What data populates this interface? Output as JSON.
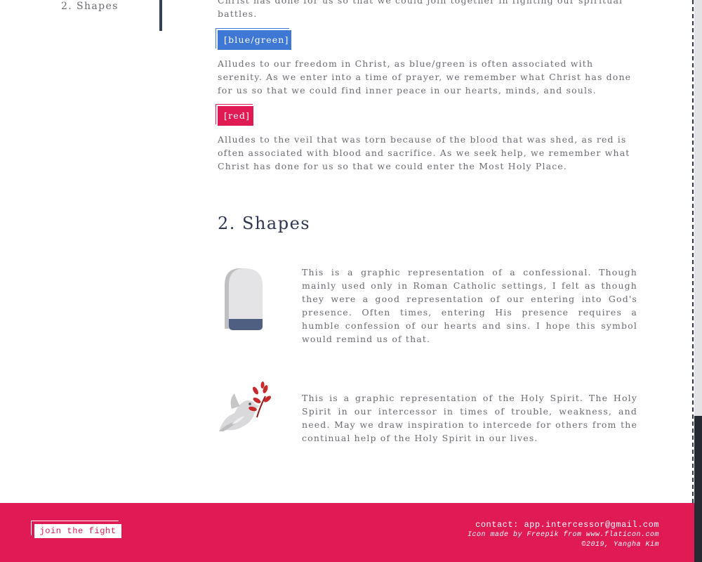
{
  "sidebar": {
    "active_item": "2. Shapes"
  },
  "colors_section": {
    "intro_tail_line1": "Christ has done for us so that we could join together in fighting our spiritual",
    "intro_tail_line2": "battles.",
    "blue_tag": "[blue/green]",
    "blue_text": "Alludes to our freedom in Christ, as blue/green is often associated with serenity. As we enter into a time of prayer, we remember what Christ has done for us so that we could find inner peace in our hearts, minds, and souls.",
    "red_tag": "[red]",
    "red_text": "Alludes to the veil that was torn because of the blood that was shed, as red is often associated with blood and sacrifice. As we seek help, we remember what Christ has done for us so that we could enter the Most Holy Place."
  },
  "shapes_section": {
    "heading": "2. Shapes",
    "confessional_icon": "confessional-icon",
    "confessional_text": "This is a graphic representation of a confessional. Though mainly used only in Roman Catholic settings, I felt as though they were a good representation of our entering into God's presence. Often times, entering His presence requires a humble confession of our hearts and sins. I hope this symbol would remind us of that.",
    "dove_icon": "dove-icon",
    "dove_text": "This is a graphic representation of the Holy Spirit. The Holy Spirit in our intercessor in times of trouble, weakness, and need. May we draw inspiration to intercede for others from the continual help of the Holy Spirit in our lives."
  },
  "footer": {
    "join_label": "join the fight",
    "contact": "contact: app.intercessor@gmail.com",
    "icon_credit": "Icon made by Freepik from www.flaticon.com",
    "copyright": "©2019, Yangha Kim"
  },
  "colors": {
    "blue_tag": "#3e78d4",
    "red_tag": "#e01b54",
    "footer_bg": "#e01b54",
    "heading": "#2e3650",
    "body_text": "#6a6a72"
  }
}
